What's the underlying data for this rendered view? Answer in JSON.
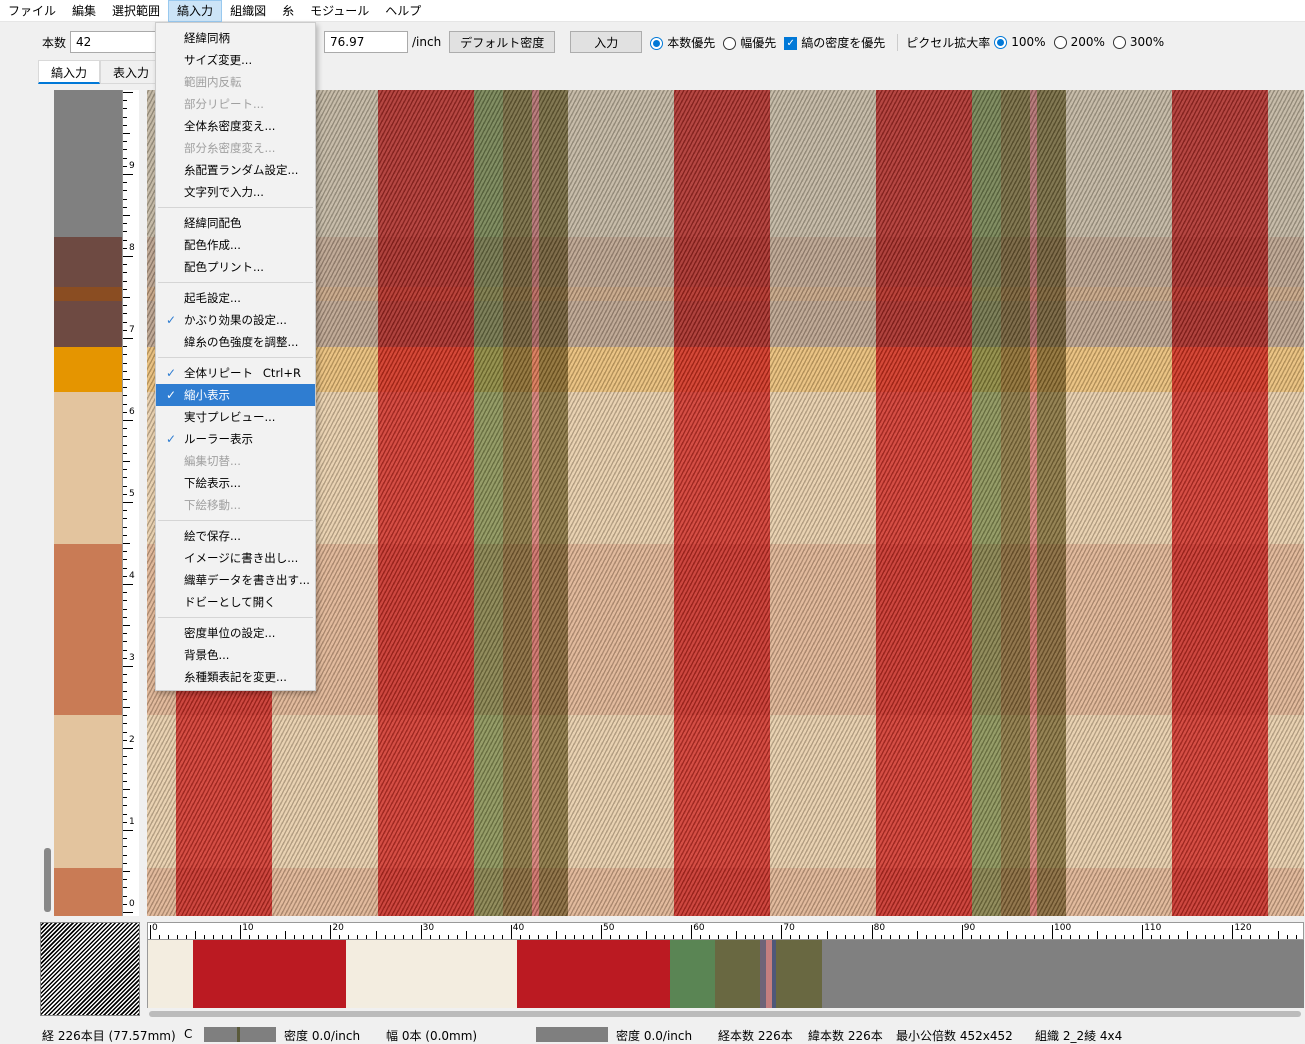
{
  "menu": [
    "ファイル",
    "編集",
    "選択範囲",
    "縞入力",
    "組織図",
    "糸",
    "モジュール",
    "ヘルプ"
  ],
  "toolbar": {
    "count_label": "本数",
    "count_value": "42",
    "density_value": "76.97",
    "density_unit": "/inch",
    "default_density_button": "デフォルト密度",
    "input_button": "入力",
    "radio_count_priority": "本数優先",
    "radio_width_priority": "幅優先",
    "stripe_density_priority_checkbox": "縞の密度を優先",
    "pixel_zoom_label": "ピクセル拡大率",
    "zoom_options": [
      "100%",
      "200%",
      "300%"
    ],
    "zoom_selected": "100%"
  },
  "tabs": [
    "縞入力",
    "表入力"
  ],
  "dropdown": {
    "items": [
      {
        "label": "経緯同柄",
        "enabled": true,
        "checked": false
      },
      {
        "label": "サイズ変更...",
        "enabled": true,
        "checked": false
      },
      {
        "label": "範囲内反転",
        "enabled": false,
        "checked": false
      },
      {
        "label": "部分リピート...",
        "enabled": false,
        "checked": false
      },
      {
        "label": "全体糸密度変え...",
        "enabled": true,
        "checked": false
      },
      {
        "label": "部分糸密度変え...",
        "enabled": false,
        "checked": false
      },
      {
        "label": "糸配置ランダム設定...",
        "enabled": true,
        "checked": false
      },
      {
        "label": "文字列で入力...",
        "enabled": true,
        "checked": false
      },
      {
        "sep": true
      },
      {
        "label": "経緯同配色",
        "enabled": true,
        "checked": false
      },
      {
        "label": "配色作成...",
        "enabled": true,
        "checked": false
      },
      {
        "label": "配色プリント...",
        "enabled": true,
        "checked": false
      },
      {
        "sep": true
      },
      {
        "label": "起毛設定...",
        "enabled": true,
        "checked": false
      },
      {
        "label": "かぶり効果の設定...",
        "enabled": true,
        "checked": true
      },
      {
        "label": "緯糸の色強度を調整...",
        "enabled": true,
        "checked": false
      },
      {
        "sep": true
      },
      {
        "label": "全体リピート",
        "enabled": true,
        "checked": true,
        "shortcut": "Ctrl+R"
      },
      {
        "label": "縮小表示",
        "enabled": true,
        "checked": true,
        "highlighted": true
      },
      {
        "label": "実寸プレビュー...",
        "enabled": true,
        "checked": false
      },
      {
        "label": "ルーラー表示",
        "enabled": true,
        "checked": true
      },
      {
        "label": "編集切替...",
        "enabled": false,
        "checked": false
      },
      {
        "label": "下絵表示...",
        "enabled": true,
        "checked": false
      },
      {
        "label": "下絵移動...",
        "enabled": false,
        "checked": false
      },
      {
        "sep": true
      },
      {
        "label": "絵で保存...",
        "enabled": true,
        "checked": false
      },
      {
        "label": "イメージに書き出し...",
        "enabled": true,
        "checked": false
      },
      {
        "label": "織華データを書き出す...",
        "enabled": true,
        "checked": false
      },
      {
        "label": "ドビーとして開く",
        "enabled": true,
        "checked": false
      },
      {
        "sep": true
      },
      {
        "label": "密度単位の設定...",
        "enabled": true,
        "checked": false
      },
      {
        "label": "背景色...",
        "enabled": true,
        "checked": false
      },
      {
        "label": "糸種類表記を変更...",
        "enabled": true,
        "checked": false
      }
    ]
  },
  "vruler_labels": [
    "9",
    "8",
    "7",
    "6",
    "5",
    "4",
    "3",
    "2",
    "1",
    "0"
  ],
  "hruler_labels": [
    "0",
    "10",
    "20",
    "30",
    "40",
    "50",
    "60",
    "70",
    "80",
    "90",
    "100",
    "110",
    "120"
  ],
  "weft_stripes": [
    {
      "color": "#808080",
      "share": 147
    },
    {
      "color": "#6e4a42",
      "share": 50
    },
    {
      "color": "#8a4d22",
      "share": 14
    },
    {
      "color": "#6e4a42",
      "share": 46
    },
    {
      "color": "#e59500",
      "share": 45
    },
    {
      "color": "#e3c49e",
      "share": 152
    },
    {
      "color": "#c97b55",
      "share": 171
    },
    {
      "color": "#e3c49e",
      "share": 153
    },
    {
      "color": "#c97b55",
      "share": 48
    }
  ],
  "warp_stripes": [
    {
      "color": "#f3ede0",
      "share": 45
    },
    {
      "color": "#bb1a22",
      "share": 153
    },
    {
      "color": "#f3ede0",
      "share": 171
    },
    {
      "color": "#bb1a22",
      "share": 153
    },
    {
      "color": "#5a8554",
      "share": 45
    },
    {
      "color": "#696841",
      "share": 45
    },
    {
      "color": "#6e6478",
      "share": 6
    },
    {
      "color": "#c47f7f",
      "share": 6
    },
    {
      "color": "#4e5879",
      "share": 4
    },
    {
      "color": "#696841",
      "share": 46
    },
    {
      "color": "#808080",
      "share": 480
    }
  ],
  "fabric": {
    "column_colors": [
      "#f2e2c8",
      "#d83a33",
      "#f2e2c8",
      "#d83a33",
      "#8fa064",
      "#8f7f4a",
      "#e08a8a",
      "#8f7f4a",
      "#f2e2c8",
      "#d83a33",
      "#f2e2c8",
      "#d83a33",
      "#8fa064",
      "#8f7f4a",
      "#e08a8a",
      "#8f7f4a",
      "#f2e2c8",
      "#d83a33",
      "#f2e2c8"
    ],
    "column_shares": [
      33,
      110,
      122,
      110,
      33,
      33,
      8,
      33,
      122,
      110,
      122,
      110,
      33,
      33,
      8,
      33,
      122,
      110,
      46
    ]
  },
  "status": {
    "warp_position": "経 226本目 (77.57mm)",
    "c_label": "C",
    "density_1": "密度 0.0/inch",
    "width": "幅 0本 (0.0mm)",
    "density_2": "密度 0.0/inch",
    "warp_count": "経本数 226本",
    "weft_count": "緯本数 226本",
    "lcm": "最小公倍数 452x452",
    "weave": "組織 2_2綾 4x4"
  }
}
